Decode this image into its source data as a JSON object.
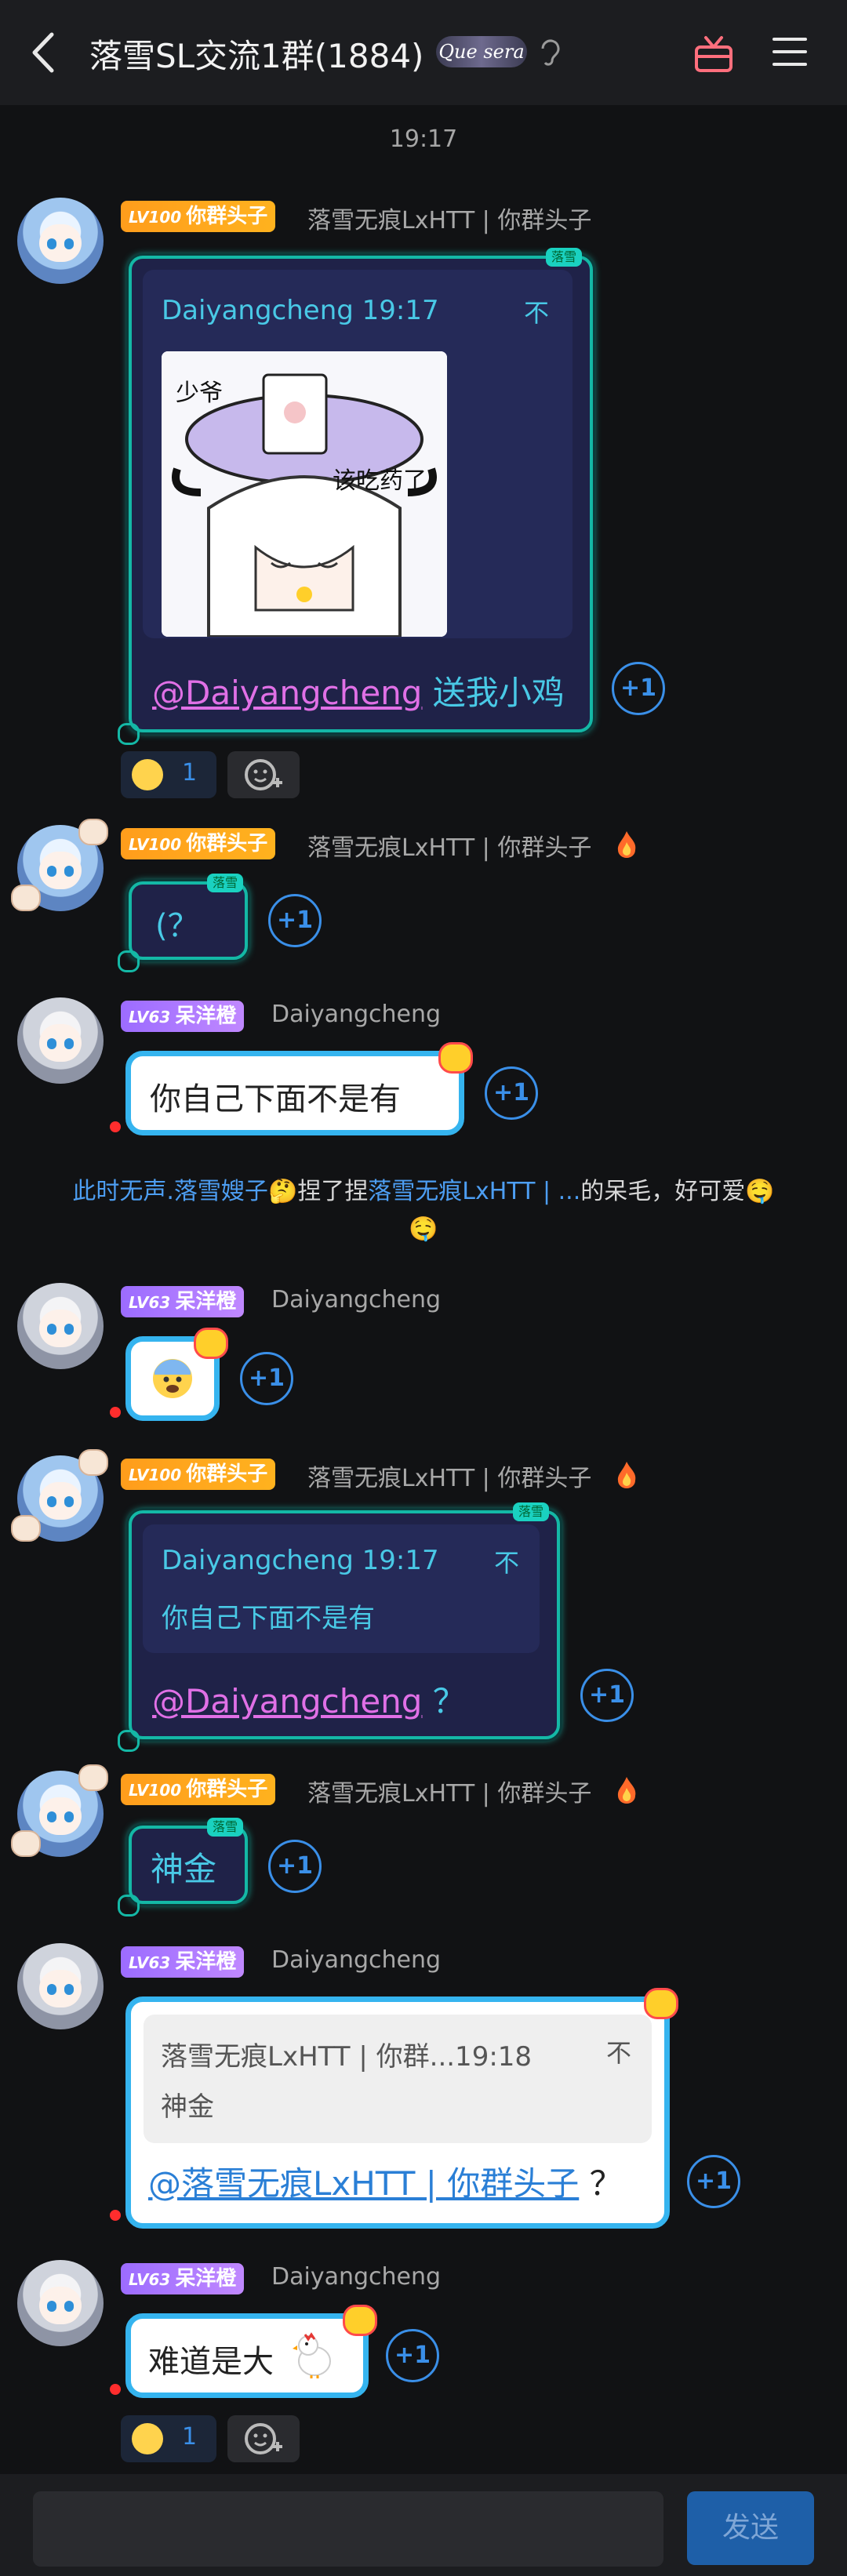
{
  "header": {
    "title": "落雪SL交流1群(1884)",
    "deco": "Que sera",
    "colors": {
      "background": "#1c1d20",
      "accent": "#ff6f7d"
    }
  },
  "timestamp": "19:17",
  "messages": [
    {
      "level": "LV100",
      "title_badge": "你群头子",
      "nickname": "落雪无痕LxHTT | 你群头子",
      "frame_tag": "落雪",
      "quote": {
        "name_time": "Daiyangcheng 19:17",
        "arrow": "不"
      },
      "sticker": {
        "top_text": "少爷",
        "bottom_text": "该吃药了"
      },
      "mention": "@Daiyangcheng",
      "text": " 送我小鸡",
      "plus_one": "+1",
      "reaction_count": "1"
    },
    {
      "level": "LV100",
      "title_badge": "你群头子",
      "nickname": "落雪无痕LxHTT | 你群头子",
      "frame_tag": "落雪",
      "text": "(？",
      "plus_one": "+1"
    },
    {
      "level": "LV63",
      "title_badge": "呆洋橙",
      "nickname": "Daiyangcheng",
      "text": "你自己下面不是有",
      "plus_one": "+1"
    },
    {
      "notice_parts": {
        "a": "此时无声.落雪嫂子",
        "b": "捏了捏",
        "c": "落雪无痕LxHTT | ...",
        "d": "的呆毛，好可爱"
      }
    },
    {
      "level": "LV63",
      "title_badge": "呆洋橙",
      "nickname": "Daiyangcheng",
      "plus_one": "+1"
    },
    {
      "level": "LV100",
      "title_badge": "你群头子",
      "nickname": "落雪无痕LxHTT | 你群头子",
      "frame_tag": "落雪",
      "quote": {
        "name_time": "Daiyangcheng 19:17",
        "arrow": "不",
        "text": "你自己下面不是有"
      },
      "mention": "@Daiyangcheng",
      "text": " ？",
      "plus_one": "+1"
    },
    {
      "level": "LV100",
      "title_badge": "你群头子",
      "nickname": "落雪无痕LxHTT | 你群头子",
      "frame_tag": "落雪",
      "text": "神金",
      "plus_one": "+1"
    },
    {
      "level": "LV63",
      "title_badge": "呆洋橙",
      "nickname": "Daiyangcheng",
      "quote": {
        "name_time": "落雪无痕LxHTT | 你群...19:18",
        "arrow": "不",
        "text": "神金"
      },
      "mention": "@落雪无痕LxHTT | 你群头子",
      "text": " ？",
      "plus_one": "+1"
    },
    {
      "level": "LV63",
      "title_badge": "呆洋橙",
      "nickname": "Daiyangcheng",
      "text": "难道是大",
      "plus_one": "+1",
      "reaction_count": "1"
    }
  ],
  "input": {
    "send_label": "发送",
    "placeholder": ""
  }
}
